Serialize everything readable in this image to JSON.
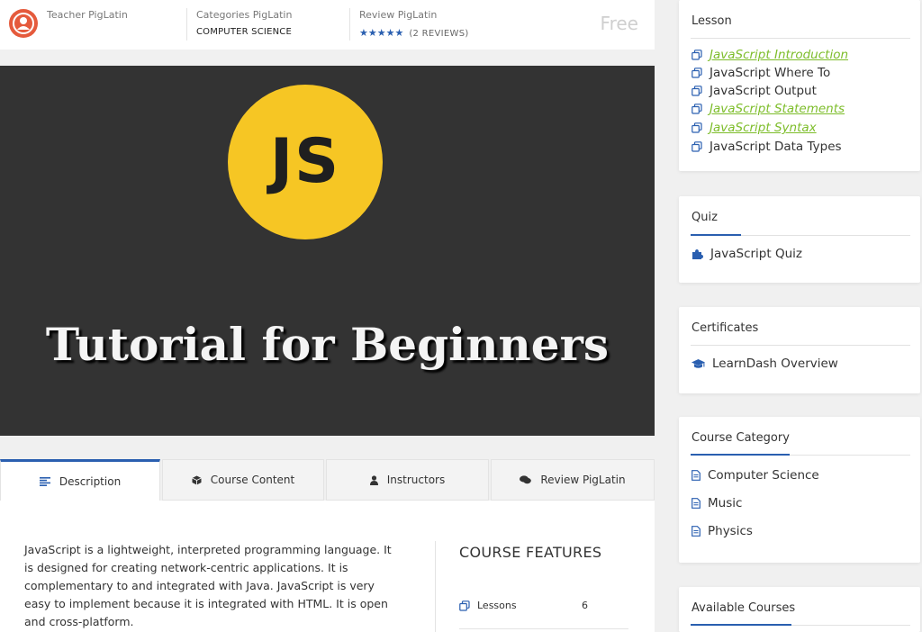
{
  "meta": {
    "teacher_label": "Teacher PigLatin",
    "category_label": "Categories PigLatin",
    "category_value": "COMPUTER SCIENCE",
    "review_label": "Review PigLatin",
    "stars": "★★★★★",
    "reviews_count": "(2 REVIEWS)",
    "price": "Free"
  },
  "hero": {
    "logo_text": "JS",
    "title": "Tutorial for Beginners",
    "logo_color": "#f6c624",
    "background": "#333333"
  },
  "tabs": [
    {
      "label": "Description",
      "icon": "align-left-icon",
      "active": true
    },
    {
      "label": "Course Content",
      "icon": "cube-icon",
      "active": false
    },
    {
      "label": "Instructors",
      "icon": "user-icon",
      "active": false
    },
    {
      "label": "Review PigLatin",
      "icon": "comments-icon",
      "active": false
    }
  ],
  "description": "JavaScript is a lightweight, interpreted programming language. It is designed for creating network-centric applications. It is complementary to and integrated with Java. JavaScript is very easy to implement because it is integrated with HTML. It is open and cross-platform.",
  "features": {
    "title": "COURSE FEATURES",
    "rows": [
      {
        "label": "Lessons",
        "value": "6",
        "icon": "copy-icon"
      }
    ]
  },
  "sidebar": {
    "lesson": {
      "title": "Lesson",
      "items": [
        {
          "label": "JavaScript Introduction",
          "link": true
        },
        {
          "label": "JavaScript Where To",
          "link": false
        },
        {
          "label": "JavaScript Output",
          "link": false
        },
        {
          "label": "JavaScript Statements",
          "link": true
        },
        {
          "label": "JavaScript Syntax",
          "link": true
        },
        {
          "label": "JavaScript Data Types",
          "link": false
        }
      ]
    },
    "quiz": {
      "title": "Quiz",
      "items": [
        {
          "label": "JavaScript Quiz"
        }
      ]
    },
    "certificates": {
      "title": "Certificates",
      "items": [
        {
          "label": "LearnDash Overview"
        }
      ]
    },
    "course_category": {
      "title": "Course Category",
      "items": [
        {
          "label": "Computer Science"
        },
        {
          "label": "Music"
        },
        {
          "label": "Physics"
        }
      ]
    },
    "available_courses": {
      "title": "Available Courses"
    }
  },
  "colors": {
    "accent": "#2a5fb0",
    "link": "#7dbd2a",
    "avatar": "#e55a3c",
    "price": "#cfcfcf"
  }
}
